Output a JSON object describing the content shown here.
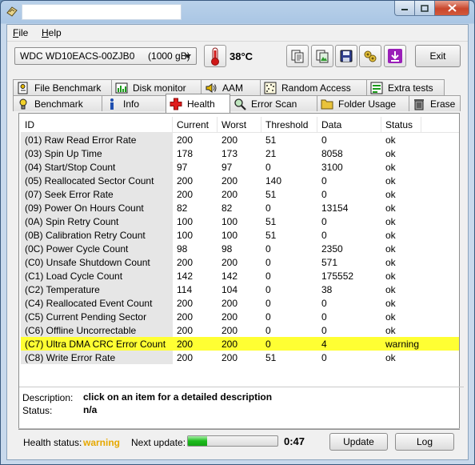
{
  "window": {
    "title": ""
  },
  "menu": {
    "file": {
      "underline": "F",
      "rest": "ile"
    },
    "help": {
      "underline": "H",
      "rest": "elp"
    }
  },
  "toolbar": {
    "drive": "WDC WD10EACS-00ZJB0     (1000 gB)",
    "temperature": "38°C",
    "exit_label": "Exit",
    "icons": [
      "copy-text-icon",
      "copy-image-icon",
      "save-icon",
      "options-icon",
      "download-icon"
    ]
  },
  "tabs": {
    "row1": [
      {
        "label": "File Benchmark",
        "icon": "file-benchmark-icon"
      },
      {
        "label": "Disk monitor",
        "icon": "disk-monitor-icon"
      },
      {
        "label": "AAM",
        "icon": "speaker-icon"
      },
      {
        "label": "Random Access",
        "icon": "random-access-icon"
      },
      {
        "label": "Extra tests",
        "icon": "extra-tests-icon"
      }
    ],
    "row2": [
      {
        "label": "Benchmark",
        "icon": "benchmark-icon"
      },
      {
        "label": "Info",
        "icon": "info-icon"
      },
      {
        "label": "Health",
        "icon": "health-cross-icon"
      },
      {
        "label": "Error Scan",
        "icon": "magnifier-icon"
      },
      {
        "label": "Folder Usage",
        "icon": "folder-icon"
      },
      {
        "label": "Erase",
        "icon": "trash-icon"
      }
    ],
    "active": "Health"
  },
  "table": {
    "columns": [
      "ID",
      "Current",
      "Worst",
      "Threshold",
      "Data",
      "Status"
    ],
    "rows": [
      [
        "(01) Raw Read Error Rate",
        "200",
        "200",
        "51",
        "0",
        "ok"
      ],
      [
        "(03) Spin Up Time",
        "178",
        "173",
        "21",
        "8058",
        "ok"
      ],
      [
        "(04) Start/Stop Count",
        "97",
        "97",
        "0",
        "3100",
        "ok"
      ],
      [
        "(05) Reallocated Sector Count",
        "200",
        "200",
        "140",
        "0",
        "ok"
      ],
      [
        "(07) Seek Error Rate",
        "200",
        "200",
        "51",
        "0",
        "ok"
      ],
      [
        "(09) Power On Hours Count",
        "82",
        "82",
        "0",
        "13154",
        "ok"
      ],
      [
        "(0A) Spin Retry Count",
        "100",
        "100",
        "51",
        "0",
        "ok"
      ],
      [
        "(0B) Calibration Retry Count",
        "100",
        "100",
        "51",
        "0",
        "ok"
      ],
      [
        "(0C) Power Cycle Count",
        "98",
        "98",
        "0",
        "2350",
        "ok"
      ],
      [
        "(C0) Unsafe Shutdown Count",
        "200",
        "200",
        "0",
        "571",
        "ok"
      ],
      [
        "(C1) Load Cycle Count",
        "142",
        "142",
        "0",
        "175552",
        "ok"
      ],
      [
        "(C2) Temperature",
        "114",
        "104",
        "0",
        "38",
        "ok"
      ],
      [
        "(C4) Reallocated Event Count",
        "200",
        "200",
        "0",
        "0",
        "ok"
      ],
      [
        "(C5) Current Pending Sector",
        "200",
        "200",
        "0",
        "0",
        "ok"
      ],
      [
        "(C6) Offline Uncorrectable",
        "200",
        "200",
        "0",
        "0",
        "ok"
      ],
      [
        "(C7) Ultra DMA CRC Error Count",
        "200",
        "200",
        "0",
        "4",
        "warning"
      ],
      [
        "(C8) Write Error Rate",
        "200",
        "200",
        "51",
        "0",
        "ok"
      ]
    ],
    "highlight_index": 15,
    "highlight_color": "#ffff33"
  },
  "description": {
    "label": "Description:",
    "value": "click on an item for a detailed description",
    "status_label": "Status:",
    "status_value": "n/a"
  },
  "footer": {
    "health_label": "Health status:",
    "health_value": "warning",
    "health_color": "#e6a800",
    "next_label": "Next update:",
    "progress_fraction": 0.21,
    "countdown": "0:47",
    "update_label": "Update",
    "log_label": "Log"
  }
}
